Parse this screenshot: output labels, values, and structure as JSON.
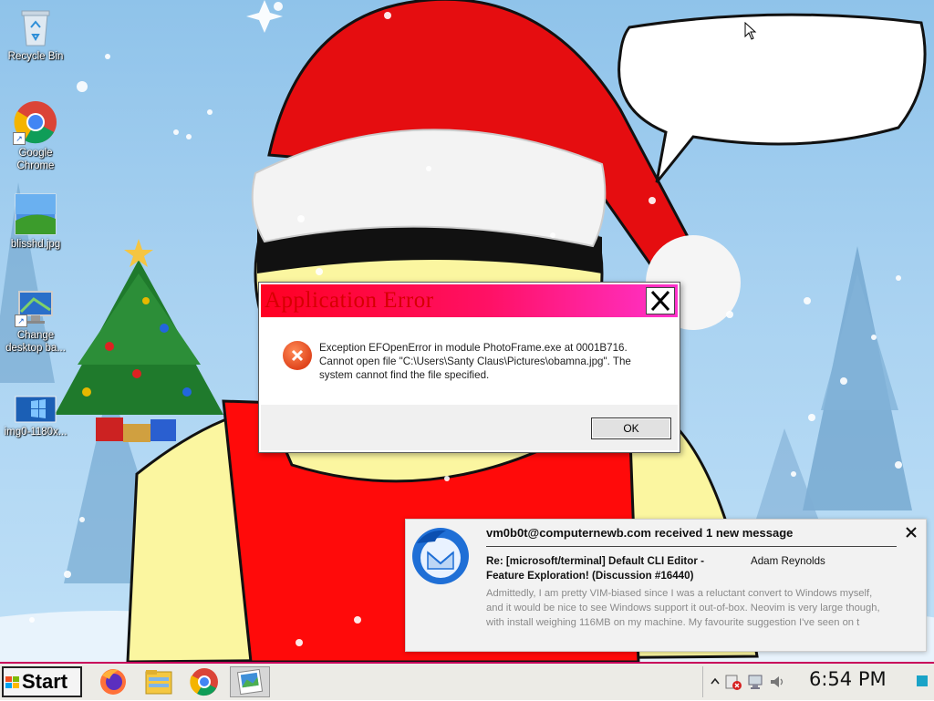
{
  "desktop": {
    "icons": [
      {
        "label": "Recycle Bin",
        "icon": "recycle-bin-icon"
      },
      {
        "label": "Google\nChrome",
        "icon": "chrome-icon"
      },
      {
        "label": "blisshd.jpg",
        "icon": "image-file-icon"
      },
      {
        "label": "Change\ndesktop ba...",
        "icon": "display-settings-icon"
      },
      {
        "label": "img0-1180x...",
        "icon": "image-file-icon"
      }
    ]
  },
  "error_dialog": {
    "title": "Application Error",
    "message": "Exception EFOpenError in module PhotoFrame.exe at 0001B716. Cannot open file \"C:\\Users\\Santy Claus\\Pictures\\obamna.jpg\". The system cannot find the file specified.",
    "ok_label": "OK"
  },
  "notification": {
    "sender": "vm0b0t@computernewb.com received 1 new message",
    "subject": "Re: [microsoft/terminal] Default CLI Editor - Feature Exploration! (Discussion #16440)",
    "author": "Adam Reynolds",
    "body": "Admittedly, I am pretty VIM-biased since I was a reluctant convert to Windows myself, and it would be nice to see Windows support it out-of-box. Neovim is very large though, with install weighing 116MB on my machine. My favourite suggestion I've seen on t"
  },
  "taskbar": {
    "start_label": "Start",
    "pinned": [
      "firefox-icon",
      "file-explorer-icon",
      "chrome-icon",
      "photo-viewer-icon"
    ],
    "tray_icons": [
      "chevron-up-icon",
      "security-warning-icon",
      "network-icon",
      "volume-icon"
    ],
    "clock": "6:54 PM"
  },
  "colors": {
    "titlebar_start": "#ff0022",
    "titlebar_end": "#ff33cc",
    "title_text": "#d60000",
    "taskbar_accent": "#c8005a"
  }
}
